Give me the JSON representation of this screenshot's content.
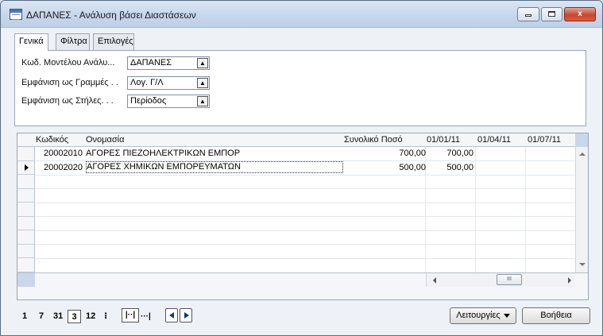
{
  "window": {
    "title": "ΔΑΠΑΝΕΣ - Ανάλυση βάσει Διαστάσεων",
    "close_glyph": "x"
  },
  "tabs": [
    {
      "label": "Γενικά",
      "active": true
    },
    {
      "label": "Φίλτρα",
      "active": false
    },
    {
      "label": "Επιλογές",
      "active": false
    }
  ],
  "general": {
    "fields": [
      {
        "label": "Κωδ. Μοντέλου Ανάλυ...",
        "value": "ΔΑΠΑΝΕΣ"
      },
      {
        "label": "Εμφάνιση ως Γραμμές . .",
        "value": "Λογ. Γ/Λ"
      },
      {
        "label": "Εμφάνιση ως Στήλες. . .",
        "value": "Περίοδος"
      }
    ]
  },
  "grid": {
    "headers": {
      "code": "Κωδικός",
      "name": "Ονομασία",
      "total": "Συνολικό Ποσό",
      "periods": [
        "01/01/11",
        "01/04/11",
        "01/07/11"
      ]
    },
    "rows": [
      {
        "code": "20002010",
        "name": "ΑΓΟΡΕΣ ΠΙΕΖΟΗΛΕΚΤΡΙΚΩΝ ΕΜΠΟΡ",
        "total": "700,00",
        "p1": "700,00",
        "p2": "",
        "p3": ""
      },
      {
        "code": "20002020",
        "name": "ΑΓΟΡΕΣ ΧΗΜΙΚΩΝ ΕΜΠΟΡΕΥΜΑΤΩΝ",
        "total": "500,00",
        "p1": "500,00",
        "p2": "",
        "p3": ""
      }
    ],
    "hscroll_thumb": "III"
  },
  "nav": {
    "periods": [
      "1",
      "7",
      "31",
      "3",
      "12"
    ],
    "selected_period": "3",
    "extra_glyph": "⁝",
    "range_left": "|··|",
    "range_right": "···|"
  },
  "buttons": {
    "functions": "Λειτουργίες",
    "help": "Βοήθεια"
  }
}
